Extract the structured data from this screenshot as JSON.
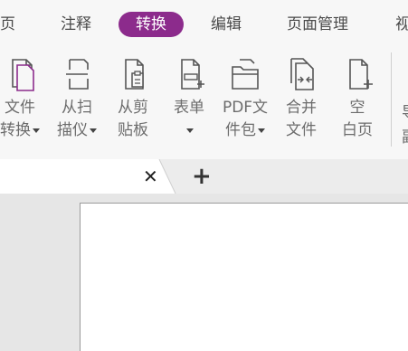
{
  "menu": {
    "tabs": [
      {
        "label": "页"
      },
      {
        "label": "注释"
      },
      {
        "label": "转换",
        "active": true
      },
      {
        "label": "编辑"
      },
      {
        "label": "页面管理"
      },
      {
        "label": "视"
      }
    ]
  },
  "ribbon": {
    "tools": [
      {
        "line1": "文件",
        "line2": "转换",
        "dropdown": true,
        "icon": "file-convert-icon"
      },
      {
        "line1": "从扫",
        "line2": "描仪",
        "dropdown": true,
        "icon": "scanner-icon"
      },
      {
        "line1": "从剪",
        "line2": "贴板",
        "dropdown": false,
        "icon": "clipboard-icon"
      },
      {
        "line1": "表单",
        "line2": "",
        "dropdown": true,
        "icon": "form-icon"
      },
      {
        "line1": "PDF文",
        "line2": "件包",
        "dropdown": true,
        "icon": "portfolio-icon"
      },
      {
        "line1": "合并",
        "line2": "文件",
        "dropdown": false,
        "icon": "combine-files-icon"
      },
      {
        "line1": "空",
        "line2": "白页",
        "dropdown": false,
        "icon": "blank-page-icon"
      }
    ],
    "cut_line1": "导",
    "cut_line2": "副"
  },
  "tabs": {
    "close_glyph": "✕",
    "add_glyph": "+"
  },
  "colors": {
    "accent": "#8c2b8c",
    "toolbar_bg": "#f7f7f7",
    "workspace_bg": "#e6e6e6"
  }
}
